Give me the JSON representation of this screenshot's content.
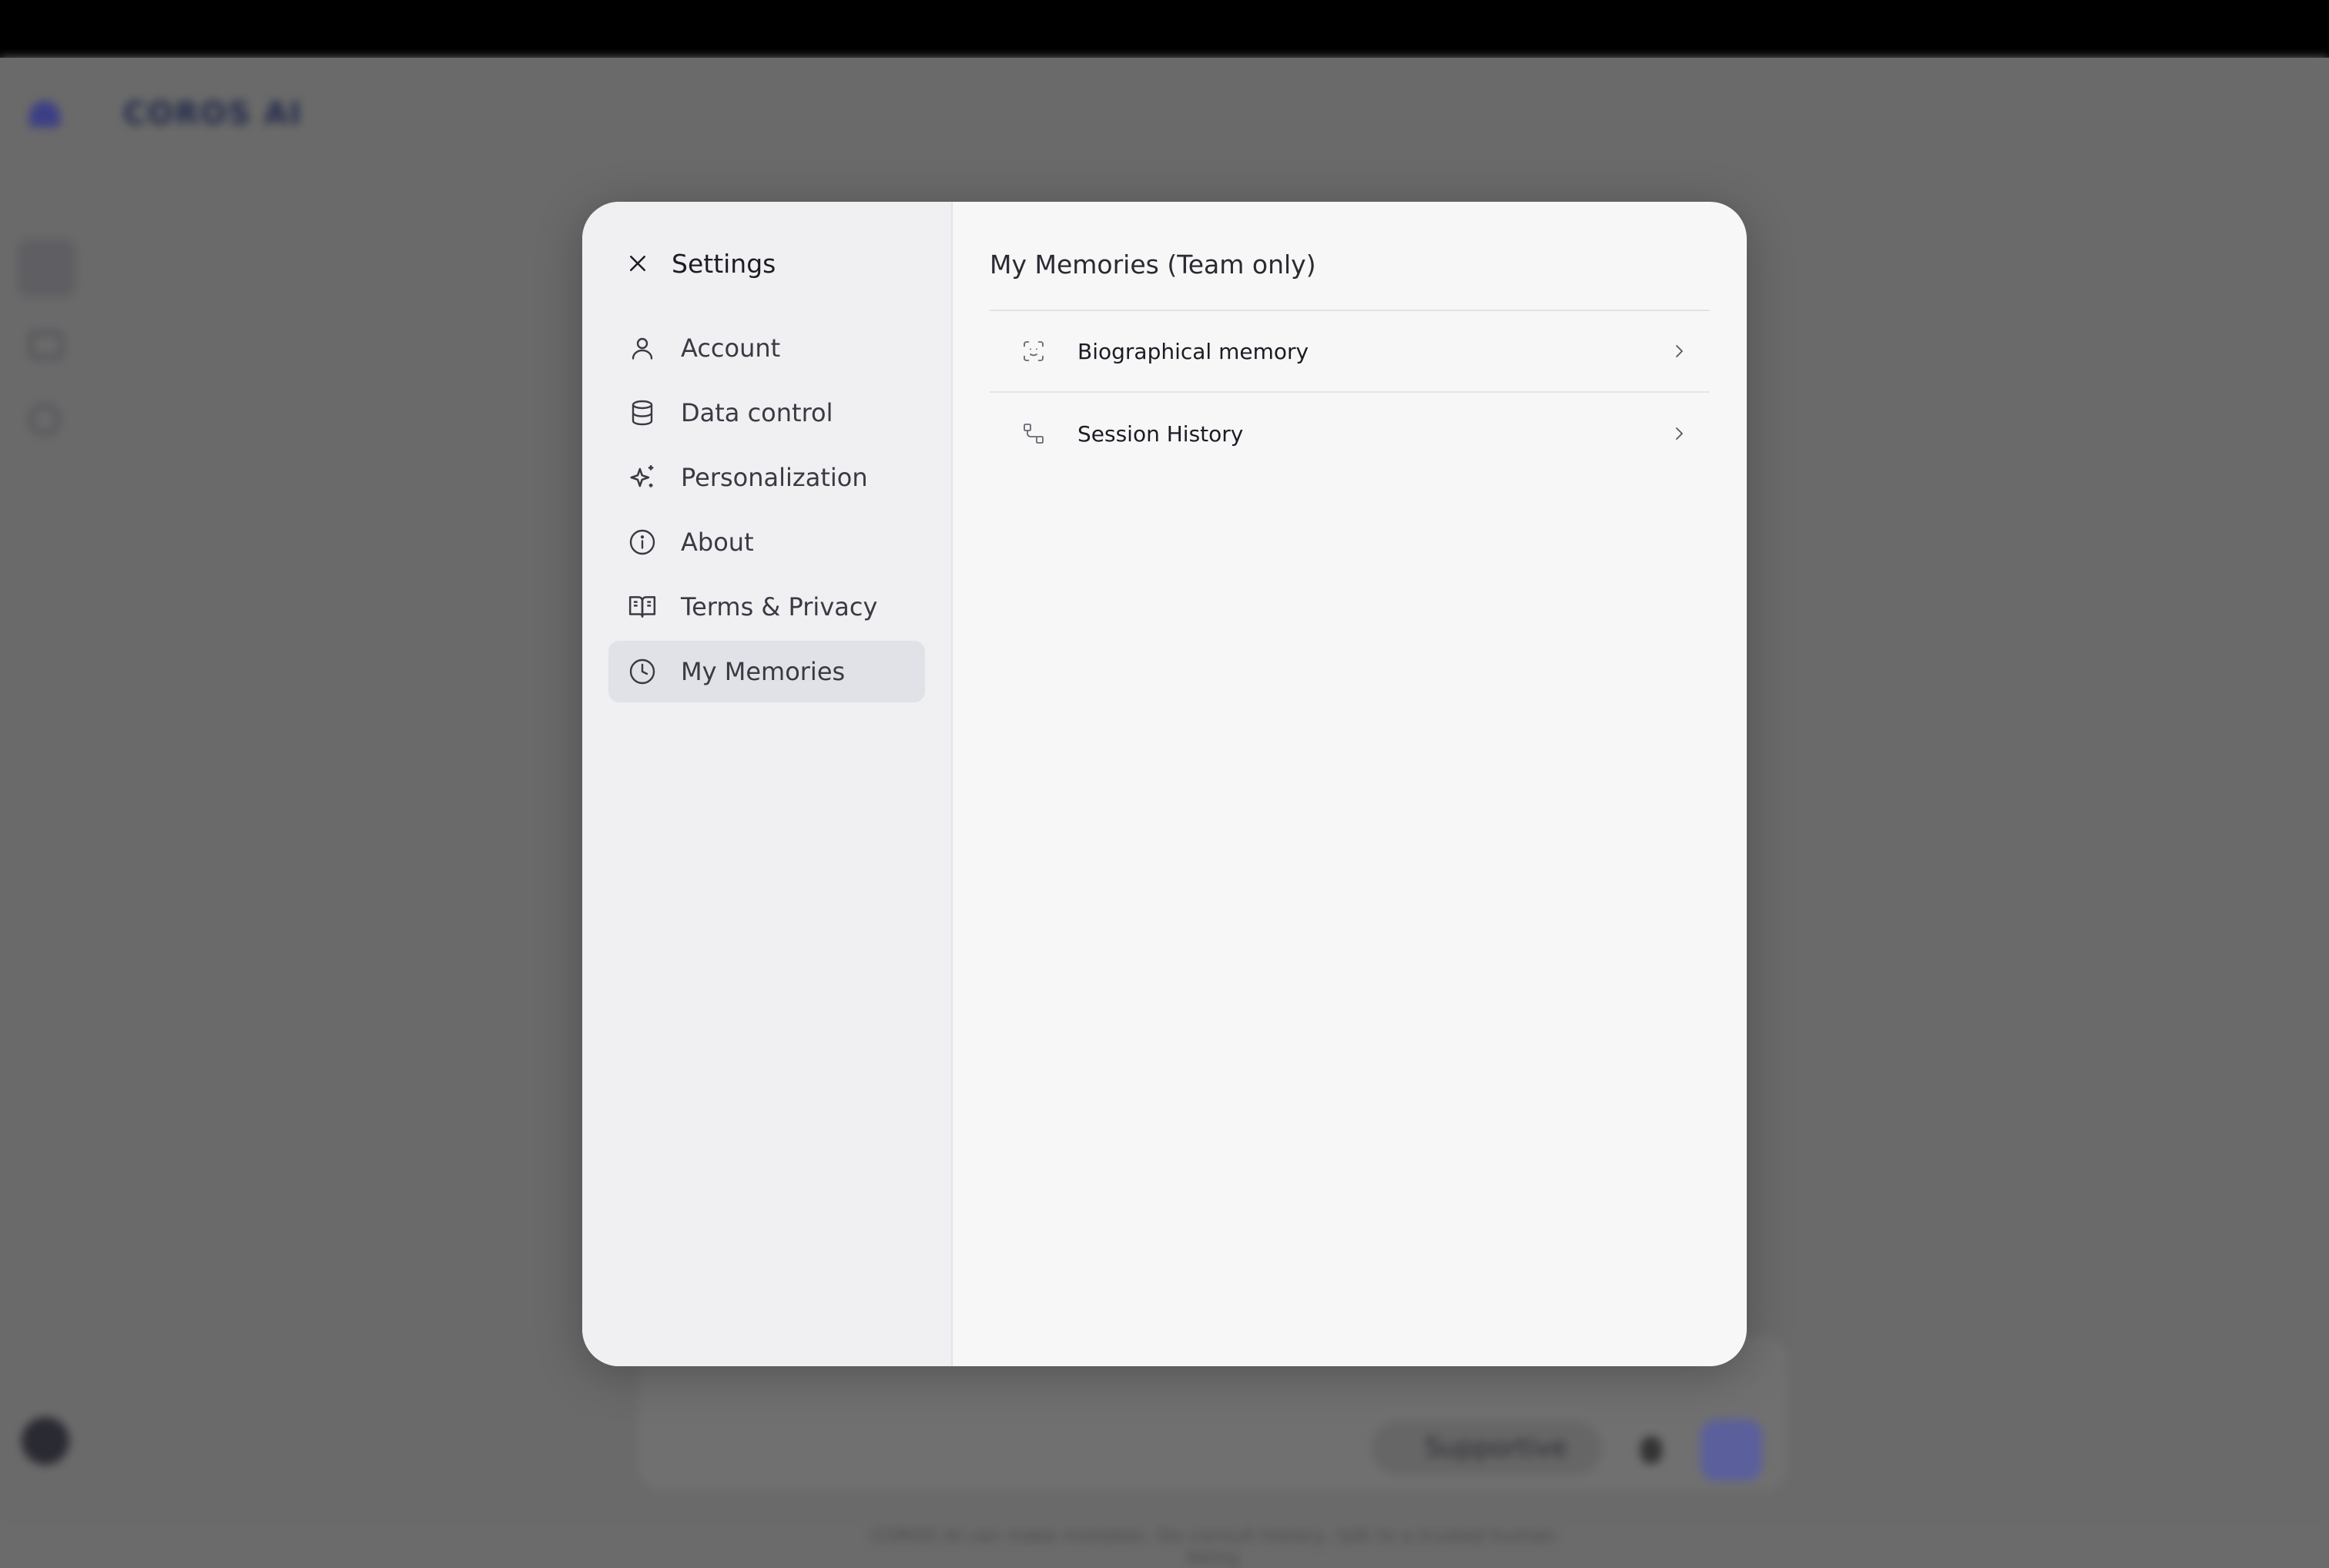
{
  "background": {
    "brand": "COROS AI",
    "mode_pill": "Supportive",
    "footer_text": "COROS AI can make mistakes. Do consult history, talk to a trusted human being"
  },
  "settings": {
    "title": "Settings",
    "nav": [
      {
        "label": "Account",
        "icon": "user-icon"
      },
      {
        "label": "Data control",
        "icon": "database-icon"
      },
      {
        "label": "Personalization",
        "icon": "sparkles-icon"
      },
      {
        "label": "About",
        "icon": "info-icon"
      },
      {
        "label": "Terms & Privacy",
        "icon": "book-open-icon"
      },
      {
        "label": "My Memories",
        "icon": "clock-icon",
        "active": true
      }
    ],
    "active_section": "My Memories"
  },
  "memories": {
    "title": "My Memories (Team only)",
    "items": [
      {
        "label": "Biographical memory",
        "icon": "face-scan-icon"
      },
      {
        "label": "Session History",
        "icon": "connect-icon"
      }
    ]
  },
  "colors": {
    "active_nav_bg": "#e1e1e8",
    "brand_accent": "#3c3f86"
  }
}
